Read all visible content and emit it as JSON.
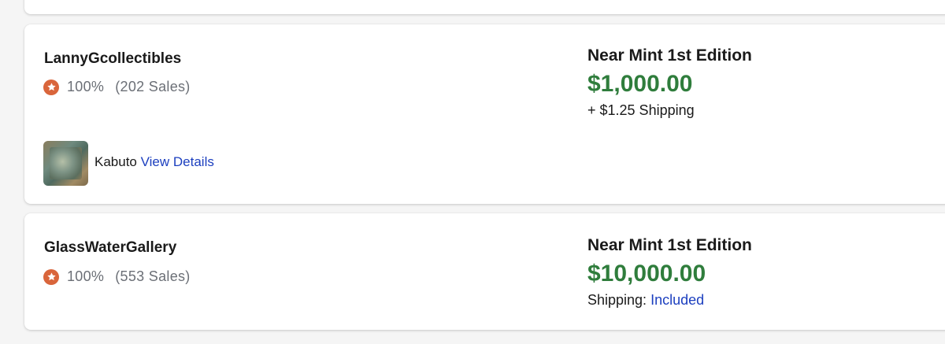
{
  "listings": [
    {
      "seller": "LannyGcollectibles",
      "rating": "100%",
      "sales": "(202 Sales)",
      "listing_name": "Kabuto",
      "details_link": "View Details",
      "condition": "Near Mint 1st Edition",
      "price": "$1,000.00",
      "shipping": "+ $1.25 Shipping"
    },
    {
      "seller": "GlassWaterGallery",
      "rating": "100%",
      "sales": "(553 Sales)",
      "condition": "Near Mint 1st Edition",
      "price": "$10,000.00",
      "shipping_label": "Shipping:",
      "shipping_value": "Included"
    }
  ],
  "colors": {
    "price": "#2f7d3c",
    "link": "#1c3fbf",
    "rating_badge": "#d9653b"
  },
  "icons": [
    "star-badge-icon",
    "card-thumbnail"
  ]
}
